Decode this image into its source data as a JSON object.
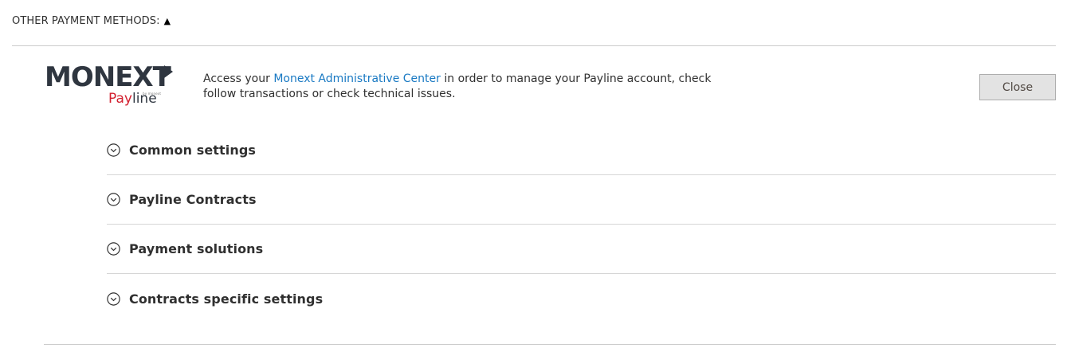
{
  "section": {
    "title": "OTHER PAYMENT METHODS:",
    "toggle_glyph": "▲"
  },
  "logo": {
    "brand": "MONEXT",
    "product_prefix": "Pay",
    "product_suffix": "line",
    "byline": "by monext"
  },
  "intro": {
    "prefix": "Access your ",
    "link_text": "Monext Administrative Center",
    "suffix": " in order to manage your Payline account, check follow transactions or check technical issues."
  },
  "close_button": {
    "label": "Close"
  },
  "groups": [
    {
      "label": "Common settings",
      "icon": "chevron-down-circle-icon"
    },
    {
      "label": "Payline Contracts",
      "icon": "chevron-down-circle-icon"
    },
    {
      "label": "Payment solutions",
      "icon": "chevron-down-circle-icon"
    },
    {
      "label": "Contracts specific settings",
      "icon": "chevron-down-circle-icon"
    }
  ],
  "colors": {
    "link": "#1979c3",
    "brand_dark": "#2f3640",
    "brand_red": "#d3202f",
    "button_bg": "#e3e3e3"
  }
}
